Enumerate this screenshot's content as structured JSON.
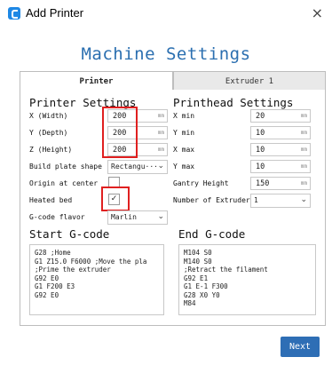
{
  "window": {
    "title": "Add Printer",
    "close_symbol": "×",
    "icon": "cura-logo-icon"
  },
  "heading": "Machine Settings",
  "tabs": [
    {
      "label": "Printer"
    },
    {
      "label": "Extruder 1"
    }
  ],
  "printer_settings": {
    "title": "Printer Settings",
    "width": {
      "label": "X (Width)",
      "value": "200",
      "unit": "mm"
    },
    "depth": {
      "label": "Y (Depth)",
      "value": "200",
      "unit": "mm"
    },
    "height": {
      "label": "Z (Height)",
      "value": "200",
      "unit": "mm"
    },
    "build_plate": {
      "label": "Build plate shape",
      "value": "Rectangu···"
    },
    "origin_center": {
      "label": "Origin at center",
      "checked": false
    },
    "heated_bed": {
      "label": "Heated bed",
      "checked": true,
      "mark": "✓"
    },
    "gcode_flavor": {
      "label": "G-code flavor",
      "value": "Marlin"
    }
  },
  "printhead_settings": {
    "title": "Printhead Settings",
    "x_min": {
      "label": "X min",
      "value": "20",
      "unit": "mm"
    },
    "y_min": {
      "label": "Y min",
      "value": "10",
      "unit": "mm"
    },
    "x_max": {
      "label": "X max",
      "value": "10",
      "unit": "mm"
    },
    "y_max": {
      "label": "Y max",
      "value": "10",
      "unit": "mm"
    },
    "gantry_height": {
      "label": "Gantry Height",
      "value": "150",
      "unit": "mm"
    },
    "num_extruders": {
      "label": "Number of Extruders",
      "value": "1"
    }
  },
  "start_gcode": {
    "title": "Start G-code",
    "text": "G28 ;Home\nG1 Z15.0 F6000 ;Move the pla\n;Prime the extruder\nG92 E0\nG1 F200 E3\nG92 E0"
  },
  "end_gcode": {
    "title": "End G-code",
    "text": "M104 S0\nM140 S0\n;Retract the filament\nG92 E1\nG1 E-1 F300\nG28 X0 Y0\nM84"
  },
  "next_label": "Next",
  "colors": {
    "accent": "#2e6eb5",
    "heading": "#2b6fb0",
    "highlight": "#e02020"
  }
}
